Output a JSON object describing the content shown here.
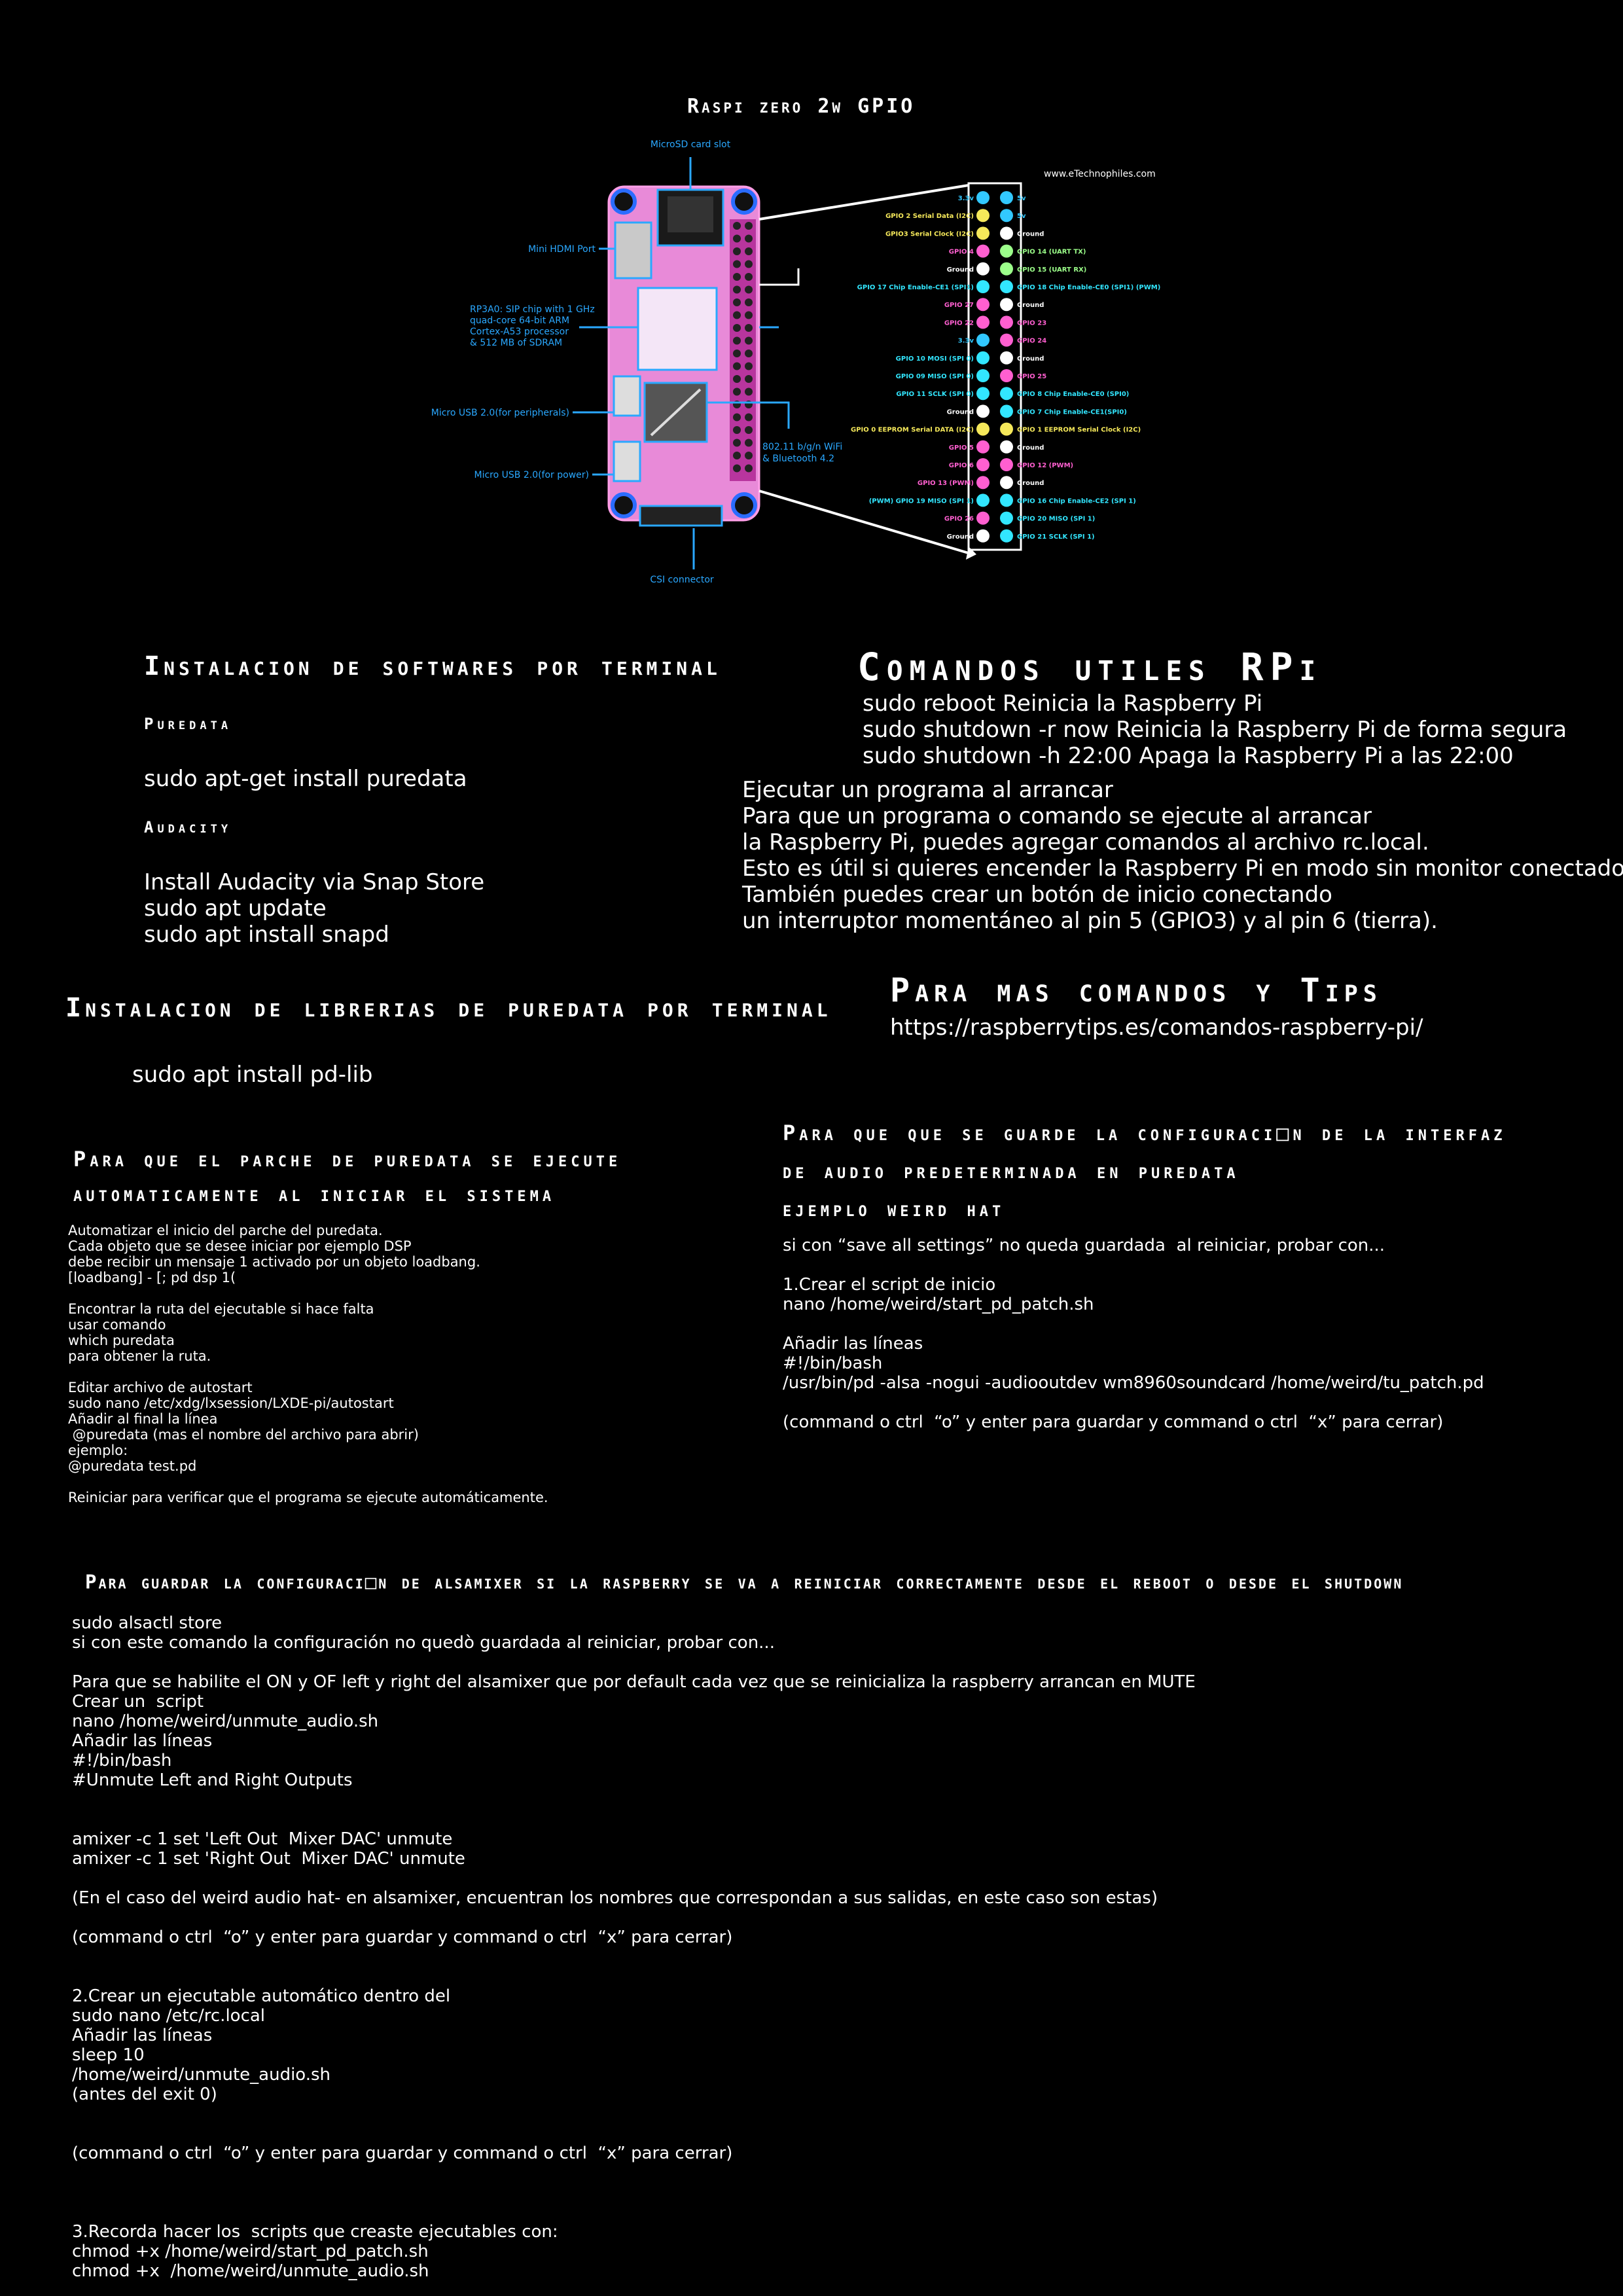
{
  "diagram": {
    "title": "Raspi zero 2w GPIO",
    "website": "www.eTechnophiles.com",
    "callouts": {
      "microsd": "MicroSD card slot",
      "hdmi": "Mini HDMI Port",
      "soc": [
        "RP3A0: SIP chip with 1 GHz",
        "quad-core 64-bit ARM",
        "Cortex-A53 processor",
        "& 512 MB of SDRAM"
      ],
      "usb_periph": "Micro USB 2.0(for peripherals)",
      "usb_power": "Micro USB 2.0(for power)",
      "wifi": [
        "802.11 b/g/n WiFi",
        "& Bluetooth 4.2"
      ],
      "csi": "CSI connector"
    },
    "pins_left": [
      {
        "label": "3.3v",
        "color": "#32c8ff"
      },
      {
        "label": "GPIO 2 Serial Data (I2C)",
        "color": "#f5e85a"
      },
      {
        "label": "GPIO3 Serial Clock (I2C)",
        "color": "#f5e85a"
      },
      {
        "label": "GPIO 4",
        "color": "#ff5fd0"
      },
      {
        "label": "Ground",
        "color": "#ffffff"
      },
      {
        "label": "GPIO 17 Chip Enable-CE1 (SPI1)",
        "color": "#32e6ff"
      },
      {
        "label": "GPIO 27",
        "color": "#ff5fd0"
      },
      {
        "label": "GPIO 22",
        "color": "#ff5fd0"
      },
      {
        "label": "3.3v",
        "color": "#32c8ff"
      },
      {
        "label": "GPIO 10 MOSI (SPI 0)",
        "color": "#32e6ff"
      },
      {
        "label": "GPIO 09 MISO (SPI 0)",
        "color": "#32e6ff"
      },
      {
        "label": "GPIO 11 SCLK (SPI 0)",
        "color": "#32e6ff"
      },
      {
        "label": "Ground",
        "color": "#ffffff"
      },
      {
        "label": "GPIO 0 EEPROM Serial DATA (I2C)",
        "color": "#f5e85a"
      },
      {
        "label": "GPIO 5",
        "color": "#ff5fd0"
      },
      {
        "label": "GPIO 6",
        "color": "#ff5fd0"
      },
      {
        "label": "GPIO 13 (PWM)",
        "color": "#ff5fd0"
      },
      {
        "label": "(PWM) GPIO 19 MISO (SPI 1)",
        "color": "#32e6ff"
      },
      {
        "label": "GPIO 26",
        "color": "#ff5fd0"
      },
      {
        "label": "Ground",
        "color": "#ffffff"
      }
    ],
    "pins_right": [
      {
        "label": "5v",
        "color": "#32c8ff"
      },
      {
        "label": "5v",
        "color": "#32c8ff"
      },
      {
        "label": "Ground",
        "color": "#ffffff"
      },
      {
        "label": "GPIO 14 (UART TX)",
        "color": "#9cff8a"
      },
      {
        "label": "GPIO 15 (UART RX)",
        "color": "#9cff8a"
      },
      {
        "label": "GPIO 18 Chip Enable-CE0 (SPI1) (PWM)",
        "color": "#32e6ff"
      },
      {
        "label": "Ground",
        "color": "#ffffff"
      },
      {
        "label": "GPIO 23",
        "color": "#ff5fd0"
      },
      {
        "label": "GPIO 24",
        "color": "#ff5fd0"
      },
      {
        "label": "Ground",
        "color": "#ffffff"
      },
      {
        "label": "GPIO 25",
        "color": "#ff5fd0"
      },
      {
        "label": "GPIO 8 Chip Enable-CE0 (SPI0)",
        "color": "#32e6ff"
      },
      {
        "label": "GPIO 7 Chip Enable-CE1(SPI0)",
        "color": "#32e6ff"
      },
      {
        "label": "GPIO 1 EEPROM Serial Clock (I2C)",
        "color": "#f5e85a"
      },
      {
        "label": "Ground",
        "color": "#ffffff"
      },
      {
        "label": "GPIO 12 (PWM)",
        "color": "#ff5fd0"
      },
      {
        "label": "Ground",
        "color": "#ffffff"
      },
      {
        "label": "GPIO 16 Chip Enable-CE2 (SPI 1)",
        "color": "#32e6ff"
      },
      {
        "label": "GPIO 20 MISO (SPI 1)",
        "color": "#32e6ff"
      },
      {
        "label": "GPIO 21 SCLK (SPI 1)",
        "color": "#32e6ff"
      }
    ],
    "colors": {
      "board": "#e88ad8",
      "callout": "#2aa8ff",
      "pin_white": "#ffffff"
    }
  },
  "install_software": {
    "title": "Instalacion de softwares por terminal",
    "puredata_heading": "Puredata",
    "puredata_cmd": "sudo apt-get install puredata",
    "audacity_heading": "Audacity",
    "audacity_lines": "Install Audacity via Snap Store\nsudo apt update\nsudo apt install snapd"
  },
  "useful_commands": {
    "title": "Comandos utiles RPi",
    "lines": "sudo reboot Reinicia la Raspberry Pi\nsudo shutdown -r now Reinicia la Raspberry Pi de forma segura\nsudo shutdown -h 22:00 Apaga la Raspberry Pi a las 22:00",
    "startup": "Ejecutar un programa al arrancar\nPara que un programa o comando se ejecute al arrancar\nla Raspberry Pi, puedes agregar comandos al archivo rc.local.\nEsto es útil si quieres encender la Raspberry Pi en modo sin monitor conectado.\nTambién puedes crear un botón de inicio conectando\nun interruptor momentáneo al pin 5 (GPIO3) y al pin 6 (tierra)."
  },
  "libraries": {
    "title": "Instalacion de librerias de puredata por terminal",
    "cmd": "sudo apt install pd-lib"
  },
  "more_tips": {
    "title": "Para mas comandos y Tips",
    "url": "https://raspberrytips.es/comandos-raspberry-pi/"
  },
  "autostart": {
    "title_line1": "Para que el parche de puredata se ejecute",
    "title_line2": "automaticamente al iniciar el sistema",
    "body": "Automatizar el inicio del parche del puredata.\nCada objeto que se desee iniciar por ejemplo DSP\ndebe recibir un mensaje 1 activado por un objeto loadbang.\n[loadbang] - [; pd dsp 1(\n\nEncontrar la ruta del ejecutable si hace falta\nusar comando\nwhich puredata\npara obtener la ruta.\n\nEditar archivo de autostart\nsudo nano /etc/xdg/lxsession/LXDE-pi/autostart\nAñadir al final la línea\n @puredata (mas el nombre del archivo para abrir)\nejemplo:\n@puredata test.pd\n\nReiniciar para verificar que el programa se ejecute automáticamente."
  },
  "audio_config": {
    "title_line1": "Para que que se guarde la configuraci□n de la interfaz",
    "title_line2": "de audio predeterminada en puredata",
    "title_line3": "ejemplo weird hat",
    "body": "si con “save all settings” no queda guardada  al reiniciar, probar con...\n\n1.Crear el script de inicio\nnano /home/weird/start_pd_patch.sh\n\nAñadir las líneas\n#!/bin/bash\n/usr/bin/pd -alsa -nogui -audiooutdev wm8960soundcard /home/weird/tu_patch.pd\n\n(command o ctrl  “o” y enter para guardar y command o ctrl  “x” para cerrar)"
  },
  "alsamixer": {
    "title": "Para guardar la configuraci□n de alsamixer si la raspberry se va a reiniciar correctamente desde el reboot o desde el shutdown",
    "body": "sudo alsactl store\nsi con este comando la configuración no quedò guardada al reiniciar, probar con...\n\nPara que se habilite el ON y OF left y right del alsamixer que por default cada vez que se reinicializa la raspberry arrancan en MUTE\nCrear un  script\nnano /home/weird/unmute_audio.sh\nAñadir las líneas\n#!/bin/bash\n#Unmute Left and Right Outputs\n\n\namixer -c 1 set 'Left Out  Mixer DAC' unmute\namixer -c 1 set 'Right Out  Mixer DAC' unmute\n\n(En el caso del weird audio hat- en alsamixer, encuentran los nombres que correspondan a sus salidas, en este caso son estas)\n\n(command o ctrl  “o” y enter para guardar y command o ctrl  “x” para cerrar)\n\n\n2.Crear un ejecutable automático dentro del\nsudo nano /etc/rc.local\nAñadir las líneas\nsleep 10\n/home/weird/unmute_audio.sh\n(antes del exit 0)\n\n\n(command o ctrl  “o” y enter para guardar y command o ctrl  “x” para cerrar)\n\n\n\n3.Recorda hacer los  scripts que creaste ejecutables con:\nchmod +x /home/weird/start_pd_patch.sh\nchmod +x  /home/weird/unmute_audio.sh"
  }
}
